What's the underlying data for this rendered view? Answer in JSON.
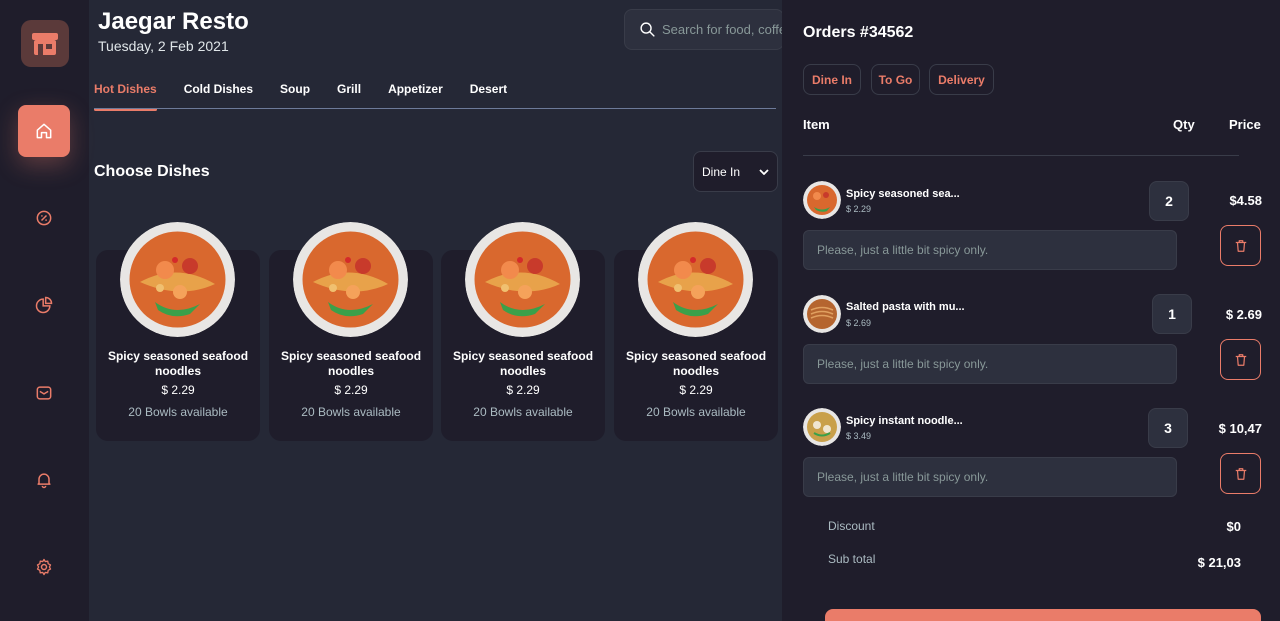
{
  "app": {
    "title": "Jaegar Resto",
    "date": "Tuesday, 2 Feb 2021"
  },
  "search": {
    "placeholder": "Search for food, coffe, etc.."
  },
  "nav": [
    "home-icon",
    "discount-icon",
    "dashboard-icon",
    "message-icon",
    "notification-icon",
    "settings-icon"
  ],
  "tabs": [
    "Hot Dishes",
    "Cold Dishes",
    "Soup",
    "Grill",
    "Appetizer",
    "Desert"
  ],
  "section": {
    "title": "Choose Dishes",
    "dine_select": "Dine In"
  },
  "dishes": [
    {
      "name": "Spicy seasoned seafood noodles",
      "price": "$ 2.29",
      "available": "20 Bowls available"
    },
    {
      "name": "Spicy seasoned seafood noodles",
      "price": "$ 2.29",
      "available": "20 Bowls available"
    },
    {
      "name": "Spicy seasoned seafood noodles",
      "price": "$ 2.29",
      "available": "20 Bowls available"
    },
    {
      "name": "Spicy seasoned seafood noodles",
      "price": "$ 2.29",
      "available": "20 Bowls available"
    }
  ],
  "orders": {
    "title": "Orders #34562",
    "types": [
      "Dine In",
      "To Go",
      "Delivery"
    ],
    "headers": {
      "item": "Item",
      "qty": "Qty",
      "price": "Price"
    },
    "items": [
      {
        "name": "Spicy seasoned sea...",
        "unit_price": "$ 2.29",
        "qty": "2",
        "total": "$4.58",
        "note": "Please, just a little bit spicy only."
      },
      {
        "name": "Salted pasta with mu...",
        "unit_price": "$ 2.69",
        "qty": "1",
        "total": "$ 2.69",
        "note": "Please, just a little bit spicy only."
      },
      {
        "name": "Spicy instant noodle...",
        "unit_price": "$ 3.49",
        "qty": "3",
        "total": "$ 10,47",
        "note": "Please, just a little bit spicy only."
      }
    ],
    "discount_label": "Discount",
    "discount_value": "$0",
    "subtotal_label": "Sub total",
    "subtotal_value": "$ 21,03"
  },
  "colors": {
    "accent": "#ea7c69",
    "background": "#252836",
    "panel": "#1f1d2b",
    "input": "#2d303e"
  }
}
